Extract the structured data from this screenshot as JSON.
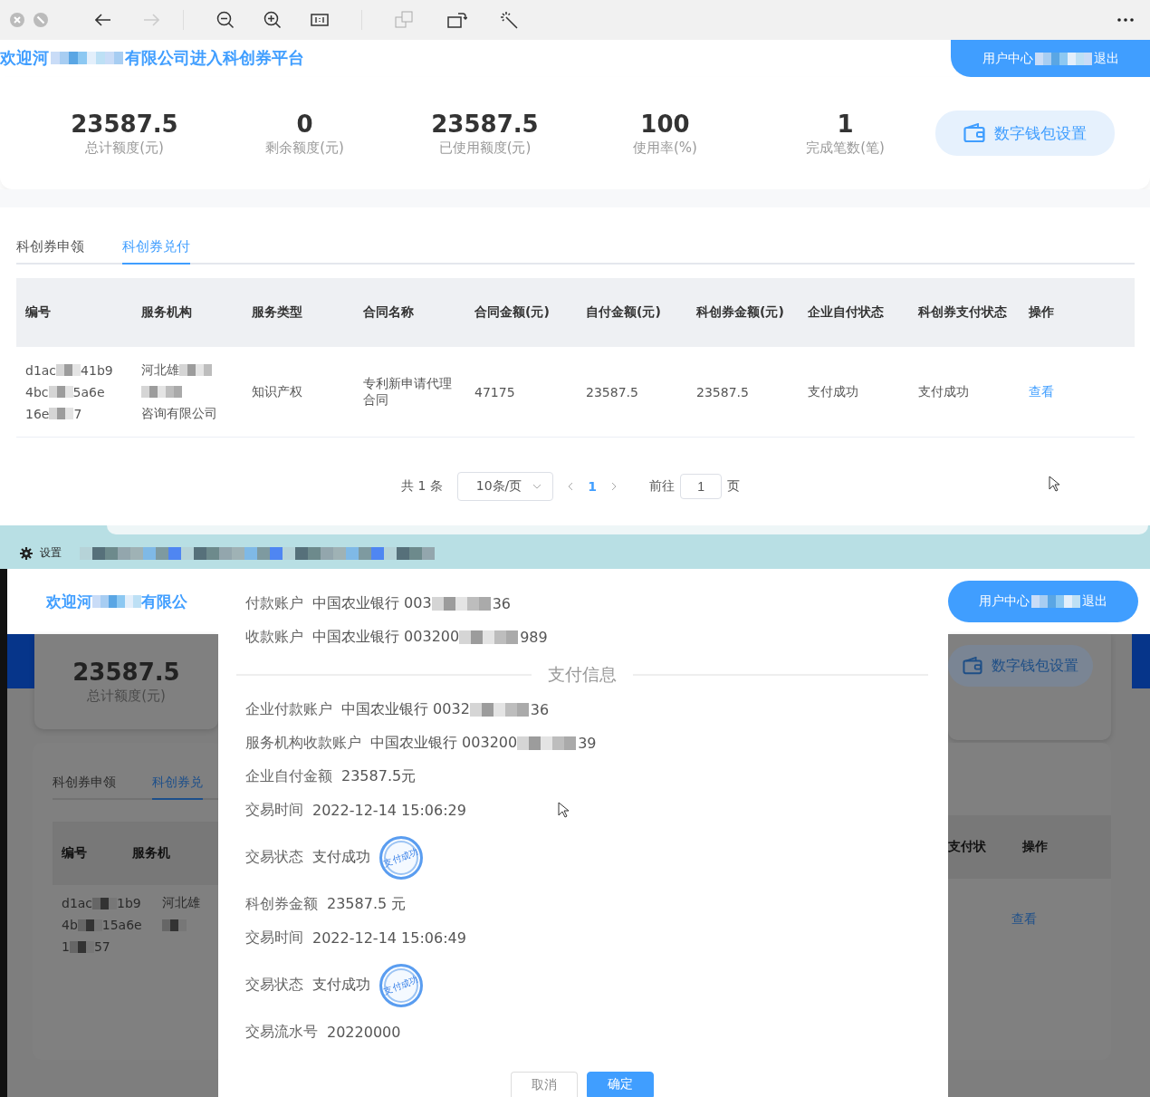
{
  "top_screen": {
    "welcome": {
      "start": "欢迎河",
      "end": "有限公司进入科创券平台"
    },
    "user_button": {
      "start": "用户中心",
      "end": "退出"
    },
    "stats": [
      {
        "value": "23587.5",
        "label": "总计额度(元)"
      },
      {
        "value": "0",
        "label": "剩余额度(元)"
      },
      {
        "value": "23587.5",
        "label": "已使用额度(元)"
      },
      {
        "value": "100",
        "label": "使用率(%)"
      },
      {
        "value": "1",
        "label": "完成笔数(笔)"
      }
    ],
    "wallet_button": "数字钱包设置",
    "tabs": [
      {
        "label": "科创券申领",
        "selected": false
      },
      {
        "label": "科创券兑付",
        "selected": true
      }
    ],
    "table": {
      "columns": [
        "编号",
        "服务机构",
        "服务类型",
        "合同名称",
        "合同金额(元)",
        "自付金额(元)",
        "科创券金额(元)",
        "企业自付状态",
        "科创券支付状态",
        "操作"
      ],
      "rows": [
        {
          "cells": [
            {
              "kind": "id",
              "lines": [
                {
                  "start": "d1ac",
                  "end": "41b9"
                },
                {
                  "start": "4bc",
                  "end": "5a6e"
                },
                {
                  "start": "16e",
                  "end": "7"
                }
              ]
            },
            {
              "kind": "org",
              "first": "河北雄",
              "last": "咨询有限公司"
            },
            {
              "kind": "text",
              "text": "知识产权"
            },
            {
              "kind": "text",
              "text": "专利新申请代理合同"
            },
            {
              "kind": "text",
              "text": "47175"
            },
            {
              "kind": "text",
              "text": "23587.5"
            },
            {
              "kind": "text",
              "text": "23587.5"
            },
            {
              "kind": "text",
              "text": "支付成功"
            },
            {
              "kind": "text",
              "text": "支付成功"
            },
            {
              "kind": "link",
              "text": "查看"
            }
          ]
        }
      ]
    },
    "pagination": {
      "total": "共 1 条",
      "page_size": "10条/页",
      "pages": [
        {
          "label": "1",
          "selected": true
        }
      ],
      "goto_label": "前往",
      "goto_value": "1",
      "goto_unit": "页"
    }
  },
  "bottom_screen": {
    "bookmarks": {
      "settings": "设置"
    },
    "welcome": {
      "start": "欢迎河",
      "end": "有限公"
    },
    "user_button": {
      "start": "用户中心",
      "end": "退出"
    },
    "stat": {
      "value": "23587.5",
      "label": "总计额度(元)"
    },
    "wallet_button": "数字钱包设置",
    "tabs": [
      {
        "label": "科创券申领",
        "selected": false
      },
      {
        "label": "科创券兑",
        "selected": true
      }
    ],
    "left_columns": [
      "编号",
      "服务机"
    ],
    "right_columns": [
      "支付状",
      "操作"
    ],
    "row": {
      "id_lines": [
        {
          "start": "d1ac",
          "end": "1b9"
        },
        {
          "start": "4b",
          "end": "15a6e"
        },
        {
          "start": "1",
          "end": "57"
        }
      ],
      "org": "河北雄",
      "action": "查看"
    },
    "dialog": {
      "fields": [
        {
          "kind": "text",
          "label": "付款账户",
          "value": "中国农业银行 003",
          "tail": "36"
        },
        {
          "kind": "text",
          "label": "收款账户",
          "value": "中国农业银行 003200",
          "tail": "989"
        }
      ],
      "section_title": "支付信息",
      "payment_fields": [
        {
          "kind": "text",
          "label": "企业付款账户",
          "value": "中国农业银行 0032",
          "tail": "36"
        },
        {
          "kind": "text",
          "label": "服务机构收款账户",
          "value": "中国农业银行 003200",
          "tail": "39"
        },
        {
          "kind": "text",
          "label": "企业自付金额",
          "value": "23587.5元"
        },
        {
          "kind": "text",
          "label": "交易时间",
          "value": "2022-12-14 15:06:29"
        },
        {
          "kind": "status",
          "label": "交易状态",
          "value": "支付成功",
          "stamp": "支付成功"
        },
        {
          "kind": "text",
          "label": "科创券金额",
          "value": "23587.5 元"
        },
        {
          "kind": "text",
          "label": "交易时间",
          "value": "2022-12-14 15:06:49"
        },
        {
          "kind": "status",
          "label": "交易状态",
          "value": "支付成功",
          "stamp": "支付成功"
        },
        {
          "kind": "text",
          "label": "交易流水号",
          "value": "20220000"
        }
      ],
      "buttons": [
        {
          "label": "取消",
          "kind": "secondary"
        },
        {
          "label": "确定",
          "kind": "primary"
        }
      ]
    }
  }
}
